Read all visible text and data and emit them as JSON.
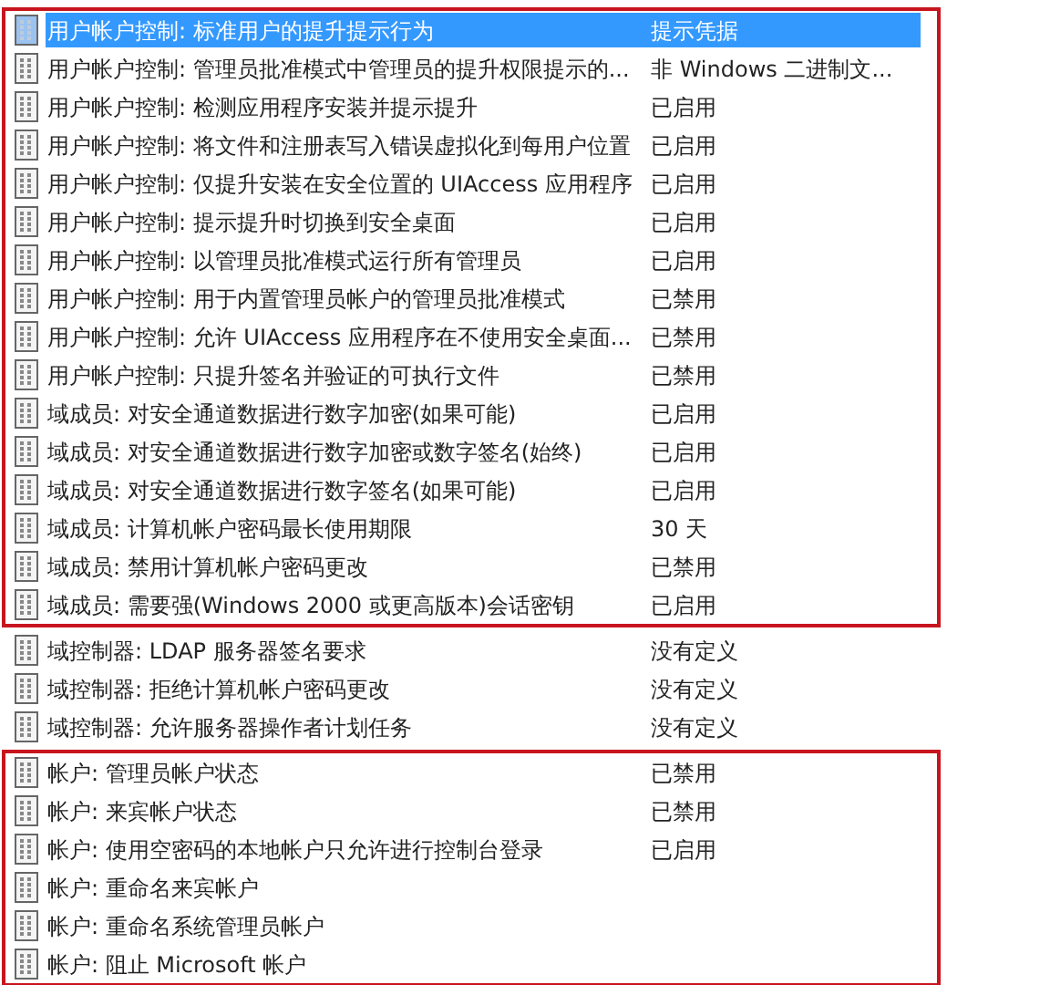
{
  "groups": [
    {
      "highlighted": true,
      "rows": [
        {
          "name": "用户帐户控制: 标准用户的提升提示行为",
          "value": "提示凭据",
          "selected": true
        },
        {
          "name": "用户帐户控制: 管理员批准模式中管理员的提升权限提示的...",
          "value": "非 Windows 二进制文...",
          "selected": false
        },
        {
          "name": "用户帐户控制: 检测应用程序安装并提示提升",
          "value": "已启用",
          "selected": false
        },
        {
          "name": "用户帐户控制: 将文件和注册表写入错误虚拟化到每用户位置",
          "value": "已启用",
          "selected": false
        },
        {
          "name": "用户帐户控制: 仅提升安装在安全位置的 UIAccess 应用程序",
          "value": "已启用",
          "selected": false
        },
        {
          "name": "用户帐户控制: 提示提升时切换到安全桌面",
          "value": "已启用",
          "selected": false
        },
        {
          "name": "用户帐户控制: 以管理员批准模式运行所有管理员",
          "value": "已启用",
          "selected": false
        },
        {
          "name": "用户帐户控制: 用于内置管理员帐户的管理员批准模式",
          "value": "已禁用",
          "selected": false
        },
        {
          "name": "用户帐户控制: 允许 UIAccess 应用程序在不使用安全桌面...",
          "value": "已禁用",
          "selected": false
        },
        {
          "name": "用户帐户控制: 只提升签名并验证的可执行文件",
          "value": "已禁用",
          "selected": false
        },
        {
          "name": "域成员: 对安全通道数据进行数字加密(如果可能)",
          "value": "已启用",
          "selected": false
        },
        {
          "name": "域成员: 对安全通道数据进行数字加密或数字签名(始终)",
          "value": "已启用",
          "selected": false
        },
        {
          "name": "域成员: 对安全通道数据进行数字签名(如果可能)",
          "value": "已启用",
          "selected": false
        },
        {
          "name": "域成员: 计算机帐户密码最长使用期限",
          "value": "30 天",
          "selected": false
        },
        {
          "name": "域成员: 禁用计算机帐户密码更改",
          "value": "已禁用",
          "selected": false
        },
        {
          "name": "域成员: 需要强(Windows 2000 或更高版本)会话密钥",
          "value": "已启用",
          "selected": false
        }
      ]
    },
    {
      "highlighted": false,
      "rows": [
        {
          "name": "域控制器: LDAP 服务器签名要求",
          "value": "没有定义",
          "selected": false
        },
        {
          "name": "域控制器: 拒绝计算机帐户密码更改",
          "value": "没有定义",
          "selected": false
        },
        {
          "name": "域控制器: 允许服务器操作者计划任务",
          "value": "没有定义",
          "selected": false
        }
      ]
    },
    {
      "highlighted": true,
      "rows": [
        {
          "name": "帐户: 管理员帐户状态",
          "value": "已禁用",
          "selected": false
        },
        {
          "name": "帐户: 来宾帐户状态",
          "value": "已禁用",
          "selected": false
        },
        {
          "name": "帐户: 使用空密码的本地帐户只允许进行控制台登录",
          "value": "已启用",
          "selected": false
        },
        {
          "name": "帐户: 重命名来宾帐户",
          "selected": false
        },
        {
          "name": "帐户: 重命名系统管理员帐户",
          "selected": false
        },
        {
          "name": "帐户: 阻止 Microsoft 帐户",
          "selected": false
        }
      ]
    }
  ]
}
